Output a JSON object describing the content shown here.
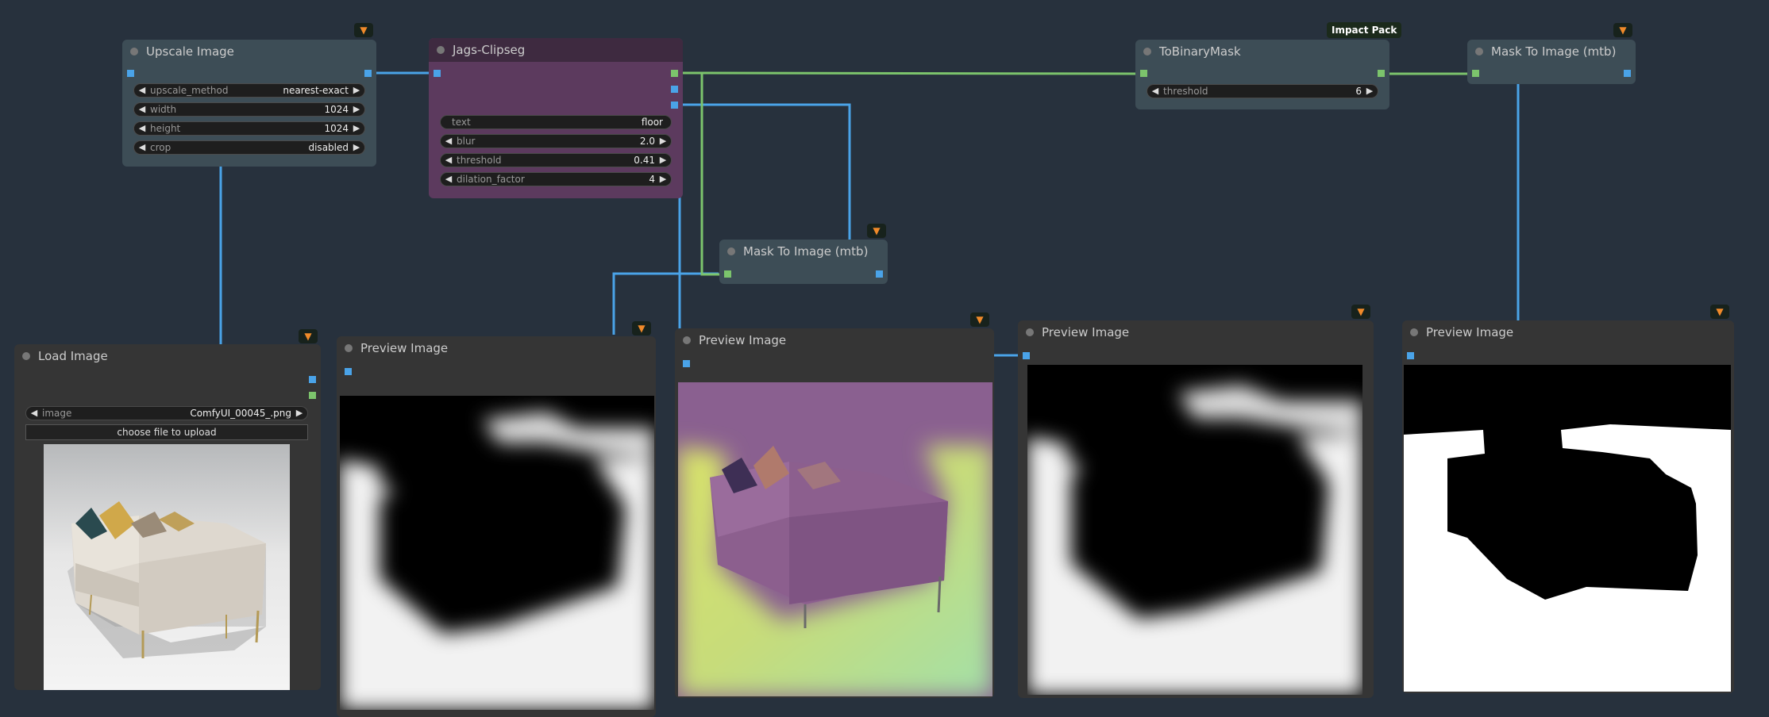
{
  "colors": {
    "canvas": "#27313d",
    "wire_image": "#4aa3e8",
    "wire_mask": "#7cc46c",
    "node_dark": "#353535",
    "node_teal": "#3d4d56",
    "node_purple": "#5c3a5e",
    "fox_icon": "#f08a2a"
  },
  "badge_icon": "fox-icon",
  "upscale": {
    "title": "Upscale Image",
    "widgets": [
      {
        "label": "upscale_method",
        "value": "nearest-exact"
      },
      {
        "label": "width",
        "value": "1024"
      },
      {
        "label": "height",
        "value": "1024"
      },
      {
        "label": "crop",
        "value": "disabled"
      }
    ]
  },
  "clipseg": {
    "title": "Jags-Clipseg",
    "text_widget": {
      "label": "text",
      "value": "floor"
    },
    "widgets": [
      {
        "label": "blur",
        "value": "2.0"
      },
      {
        "label": "threshold",
        "value": "0.41"
      },
      {
        "label": "dilation_factor",
        "value": "4"
      }
    ]
  },
  "binary_mask": {
    "title": "ToBinaryMask",
    "pack_label": "Impact Pack",
    "widget": {
      "label": "threshold",
      "value": "6"
    }
  },
  "mask_to_image_top": {
    "title": "Mask To Image (mtb)"
  },
  "mask_to_image_mid": {
    "title": "Mask To Image (mtb)"
  },
  "load_image": {
    "title": "Load Image",
    "widget": {
      "label": "image",
      "value": "ComfyUI_00045_.png"
    },
    "upload_label": "choose file to upload"
  },
  "previews": [
    {
      "title": "Preview Image"
    },
    {
      "title": "Preview Image"
    },
    {
      "title": "Preview Image"
    },
    {
      "title": "Preview Image"
    }
  ]
}
